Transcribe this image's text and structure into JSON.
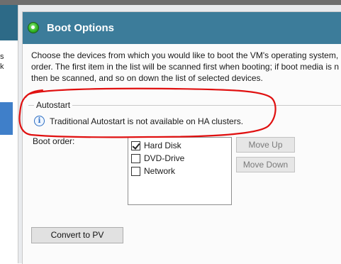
{
  "left_pane": {
    "fragments": [
      "s",
      "k"
    ]
  },
  "dialog": {
    "title": "Boot Options",
    "description_lines": [
      "Choose the devices from which you would like to boot the VM's operating system, a",
      "order. The first item in the list will be scanned first when booting; if boot media is n",
      "then be scanned, and so on down the list of selected devices."
    ],
    "autostart": {
      "legend": "Autostart",
      "message": "Traditional Autostart is not available on HA clusters.",
      "icon": "info-icon"
    },
    "boot_order": {
      "label": "Boot order:",
      "devices": [
        {
          "label": "Hard Disk",
          "checked": true
        },
        {
          "label": "DVD-Drive",
          "checked": false
        },
        {
          "label": "Network",
          "checked": false
        }
      ]
    },
    "buttons": {
      "move_up": "Move Up",
      "move_down": "Move Down",
      "convert": "Convert to PV"
    }
  },
  "colors": {
    "header": "#3c7c9a",
    "status": "#31b625",
    "annotation": "#e01010"
  }
}
